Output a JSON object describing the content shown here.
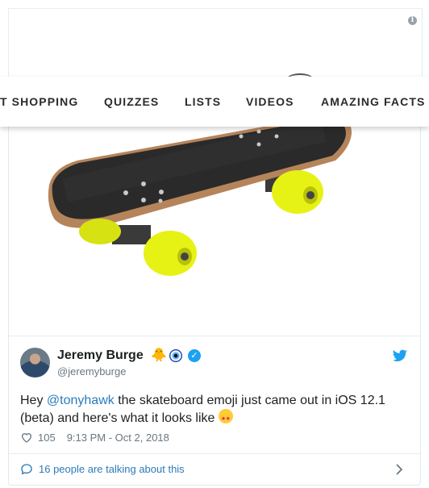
{
  "ad": {
    "info_icon": "info-icon",
    "info_glyph": "i"
  },
  "nav": {
    "items": [
      "T SHOPPING",
      "QUIZZES",
      "LISTS",
      "VIDEOS",
      "AMAZING FACTS"
    ]
  },
  "tweet": {
    "media_icon": "skateboard-image",
    "author": {
      "name": "Jeremy Burge",
      "handle": "@jeremyburge",
      "emoji_1": "🐥",
      "emoji_2": "nazar-amulet-emoji",
      "verified_icon": "verified-badge-icon"
    },
    "text_before": "Hey ",
    "mention": "@tonyhawk",
    "text_after": " the skateboard emoji just came out in iOS 12.1 (beta) and here's what it looks like ",
    "end_emoji": "star-struck-emoji",
    "likes": "105",
    "timestamp": "9:13 PM - Oct 2, 2018",
    "talking": "16 people are talking about this"
  },
  "colors": {
    "twitter_blue": "#1da1f2",
    "link_blue": "#2b7bb9",
    "meta_gray": "#697882",
    "wheel_yellow": "#e6f214",
    "deck_grip": "#2a2a2a",
    "deck_wood": "#b5845a"
  }
}
